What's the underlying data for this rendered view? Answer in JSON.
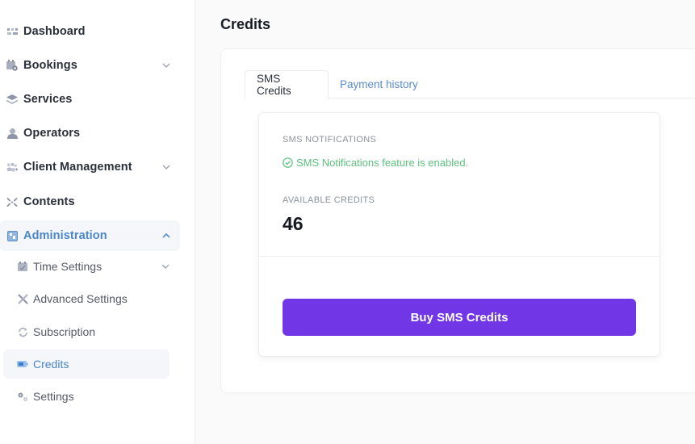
{
  "sidebar": {
    "items": [
      {
        "label": "Dashboard",
        "icon": "dashboard-icon"
      },
      {
        "label": "Bookings",
        "icon": "calendar-icon",
        "expandable": true,
        "expanded": false
      },
      {
        "label": "Services",
        "icon": "layers-icon"
      },
      {
        "label": "Operators",
        "icon": "user-icon"
      },
      {
        "label": "Client Management",
        "icon": "users-icon",
        "expandable": true,
        "expanded": false
      },
      {
        "label": "Contents",
        "icon": "contents-icon"
      },
      {
        "label": "Administration",
        "icon": "admin-icon",
        "expandable": true,
        "expanded": true,
        "active": true
      }
    ],
    "subitems": [
      {
        "label": "Time Settings",
        "icon": "calendar-check-icon",
        "expandable": true
      },
      {
        "label": "Advanced Settings",
        "icon": "tools-icon"
      },
      {
        "label": "Subscription",
        "icon": "refresh-icon"
      },
      {
        "label": "Credits",
        "icon": "battery-icon",
        "active": true
      },
      {
        "label": "Settings",
        "icon": "gears-icon"
      }
    ]
  },
  "main": {
    "title": "Credits",
    "tabs": [
      {
        "label": "SMS Credits",
        "active": true
      },
      {
        "label": "Payment history",
        "active": false
      }
    ],
    "card": {
      "sms_notifications_label": "SMS NOTIFICATIONS",
      "status_text": "SMS Notifications feature is enabled.",
      "available_credits_label": "AVAILABLE CREDITS",
      "available_credits_value": "46",
      "buy_button_label": "Buy SMS Credits"
    }
  },
  "colors": {
    "accent": "#7137e6",
    "active_link": "#4a86c8",
    "success": "#5cbf7d"
  }
}
